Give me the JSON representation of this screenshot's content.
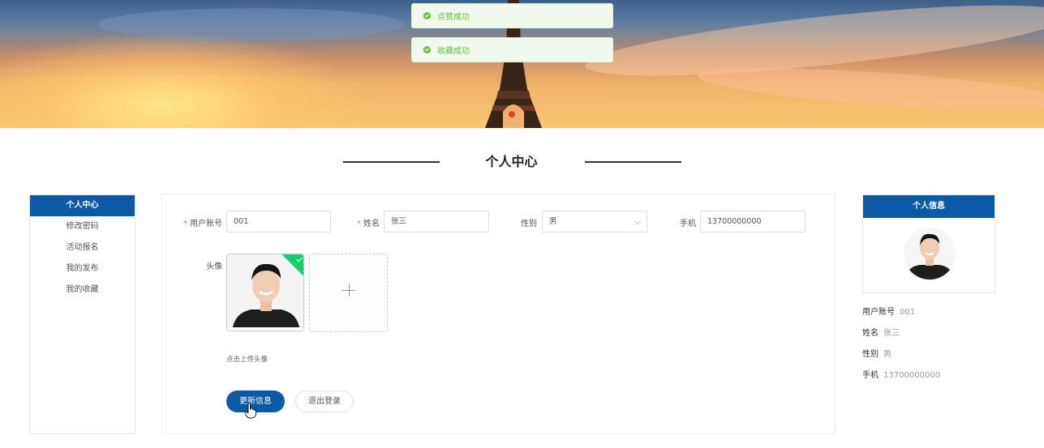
{
  "toasts": [
    {
      "text": "点赞成功"
    },
    {
      "text": "收藏成功"
    }
  ],
  "page_title": "个人中心",
  "left_menu": {
    "header": "个人中心",
    "items": [
      "修改密码",
      "活动报名",
      "我的发布",
      "我的收藏"
    ]
  },
  "form": {
    "account": {
      "label": "用户账号",
      "value": "001"
    },
    "name": {
      "label": "姓名",
      "value": "张三"
    },
    "gender": {
      "label": "性别",
      "value": "男"
    },
    "phone": {
      "label": "手机",
      "value": "13700000000"
    },
    "avatar": {
      "label": "头像",
      "hint": "点击上传头像"
    },
    "update_button": "更新信息",
    "logout_button": "退出登录"
  },
  "profile_card": {
    "header": "个人信息",
    "rows": [
      {
        "label": "用户账号",
        "value": "001"
      },
      {
        "label": "姓名",
        "value": "张三"
      },
      {
        "label": "性别",
        "value": "男"
      },
      {
        "label": "手机",
        "value": "13700000000"
      }
    ]
  },
  "icons": {
    "toast": "success-check-icon",
    "upload": "plus-icon",
    "select": "chevron-down-icon",
    "cursor": "hand-pointer-icon"
  },
  "colors": {
    "primary": "#0b5aa7",
    "success": "#67c23a",
    "required": "#f56c6c"
  }
}
